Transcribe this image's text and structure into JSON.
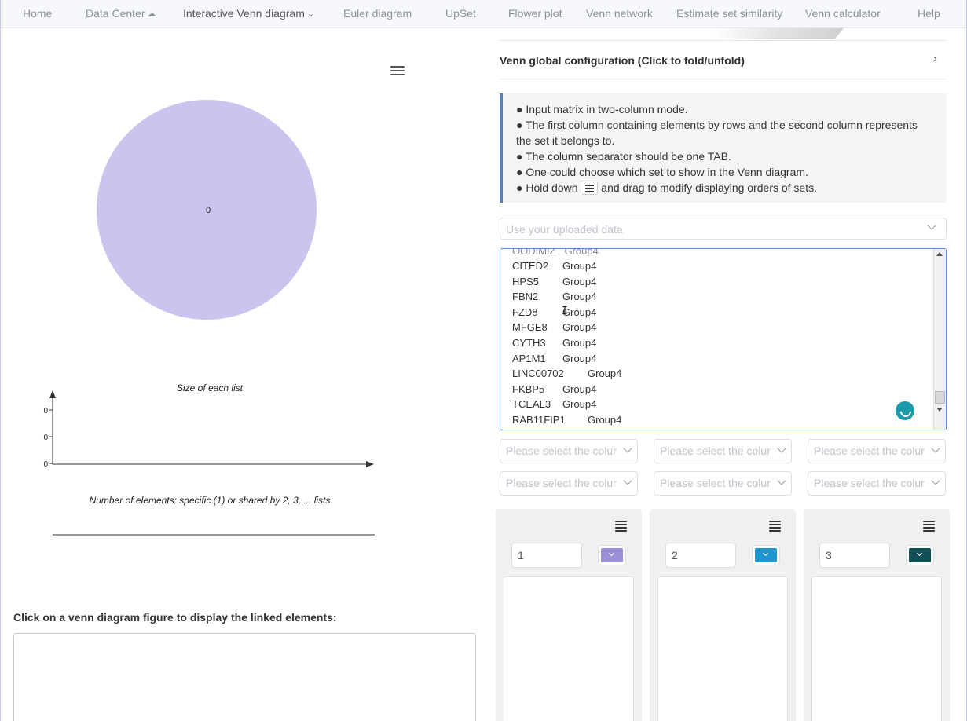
{
  "nav": {
    "items": [
      {
        "label": "Home"
      },
      {
        "label": "Data Center"
      },
      {
        "label": "Interactive Venn diagram"
      },
      {
        "label": "Euler diagram"
      },
      {
        "label": "UpSet"
      },
      {
        "label": "Flower plot"
      },
      {
        "label": "Venn network"
      },
      {
        "label": "Estimate set similarity"
      },
      {
        "label": "Venn calculator"
      },
      {
        "label": "Help"
      }
    ],
    "active_index": 2,
    "data_center_icon": "cloud-upload-icon",
    "dropdown_icon": "chevron-down-icon"
  },
  "venn": {
    "region_label": "0",
    "circle_color": "#cdc3ef"
  },
  "upset": {
    "title": "Size of each list",
    "y_ticks": [
      "0",
      "0",
      "0"
    ],
    "caption": "Number of elements: specific (1) or shared by 2, 3, ... lists"
  },
  "linked": {
    "label": "Click on a venn diagram figure to display the linked elements:"
  },
  "config": {
    "title": "Venn global configuration (Click to fold/unfold)"
  },
  "info": {
    "lines": [
      "Input matrix in two-column mode.",
      "The first column containing elements by rows and the second column represents the set it belongs to.",
      "The column separator should be one TAB.",
      "One could choose which set to show in the Venn diagram."
    ],
    "hold_prefix": "Hold down",
    "hold_suffix": "and drag to modify displaying orders of sets."
  },
  "data_select": {
    "placeholder": "Use your uploaded data"
  },
  "matrix_rows": [
    {
      "gene": "CITED2",
      "group": "Group4"
    },
    {
      "gene": "HPS5",
      "group": "Group4"
    },
    {
      "gene": "FBN2",
      "group": "Group4"
    },
    {
      "gene": "FZD8",
      "group": "Group4"
    },
    {
      "gene": "MFGE8",
      "group": "Group4"
    },
    {
      "gene": "CYTH3",
      "group": "Group4"
    },
    {
      "gene": "AP1M1",
      "group": "Group4"
    },
    {
      "gene": "LINC00702",
      "group": "Group4"
    },
    {
      "gene": "FKBP5",
      "group": "Group4"
    },
    {
      "gene": "TCEAL3",
      "group": "Group4"
    },
    {
      "gene": "RAB11FIP1",
      "group": "Group4"
    }
  ],
  "column_select": {
    "placeholder": "Please select the column"
  },
  "sets": [
    {
      "name": "1",
      "color": "#9b8fd8"
    },
    {
      "name": "2",
      "color": "#1f95cf"
    },
    {
      "name": "3",
      "color": "#0f4f55"
    }
  ]
}
